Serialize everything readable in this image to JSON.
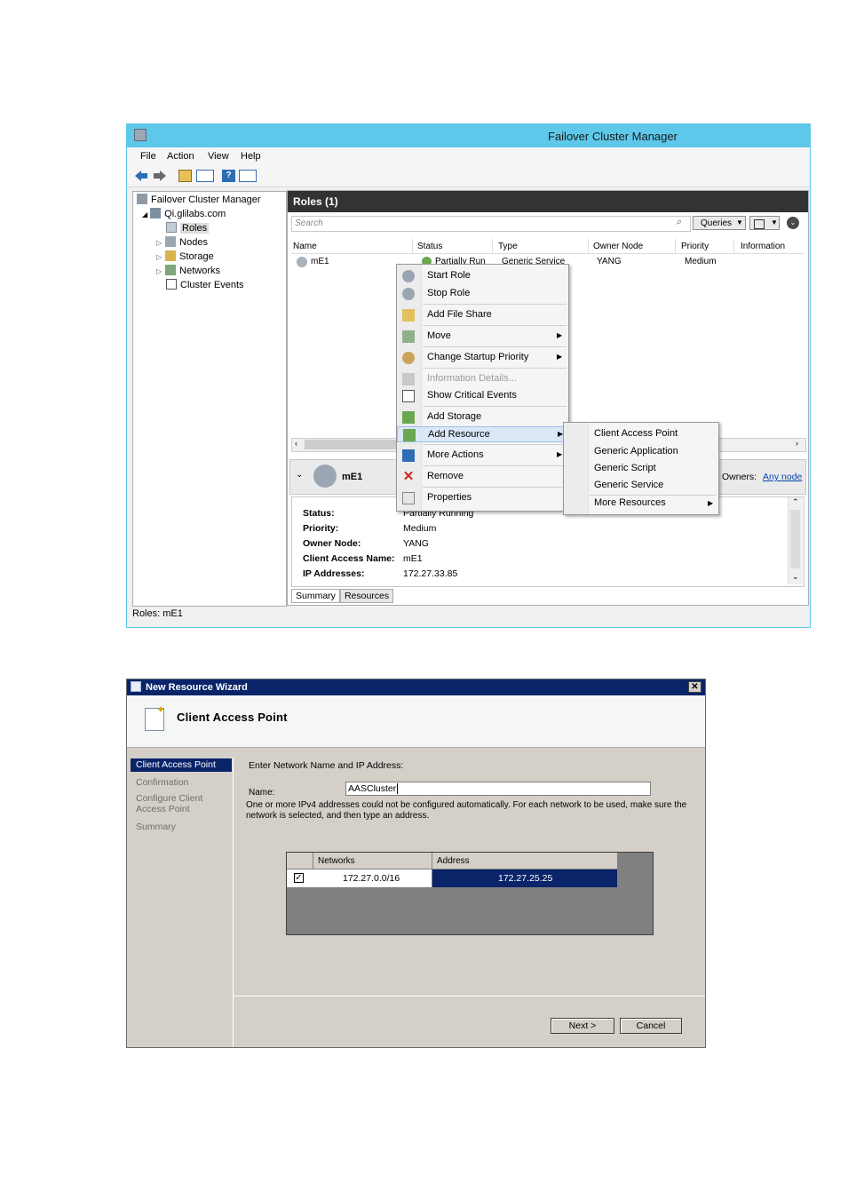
{
  "fcm": {
    "window_title": "Failover Cluster Manager",
    "menu": [
      "File",
      "Action",
      "View",
      "Help"
    ],
    "tree": {
      "root": "Failover Cluster Manager",
      "cluster": "Qi.glilabs.com",
      "items": [
        "Roles",
        "Nodes",
        "Storage",
        "Networks",
        "Cluster Events"
      ]
    },
    "roles_pane": {
      "header": "Roles (1)",
      "search_placeholder": "Search",
      "queries_label": "Queries",
      "columns": [
        "Name",
        "Status",
        "Type",
        "Owner Node",
        "Priority",
        "Information"
      ],
      "row": {
        "name": "mE1",
        "status": "Partially Run",
        "type": "Generic Service",
        "owner_node": "YANG",
        "priority": "Medium",
        "information": ""
      }
    },
    "details": {
      "title": "mE1",
      "owners_label": "Owners:",
      "owners_value": "Any node",
      "fields": [
        {
          "label": "Status:",
          "value": "Partially Running"
        },
        {
          "label": "Priority:",
          "value": "Medium"
        },
        {
          "label": "Owner Node:",
          "value": "YANG"
        },
        {
          "label": "Client Access Name:",
          "value": "mE1"
        },
        {
          "label": "IP Addresses:",
          "value": "172.27.33.85"
        }
      ],
      "tabs": [
        "Summary",
        "Resources"
      ]
    },
    "context_menu": [
      {
        "label": "Start Role",
        "icon": "start-role-icon"
      },
      {
        "label": "Stop Role",
        "icon": "stop-role-icon"
      },
      {
        "label": "Add File Share",
        "icon": "file-share-icon"
      },
      {
        "label": "Move",
        "icon": "move-icon",
        "submenu": true
      },
      {
        "label": "Change Startup Priority",
        "icon": "priority-icon",
        "submenu": true
      },
      {
        "label": "Information Details...",
        "icon": "info-details-icon",
        "disabled": true
      },
      {
        "label": "Show Critical Events",
        "icon": "events-icon"
      },
      {
        "label": "Add Storage",
        "icon": "add-storage-icon"
      },
      {
        "label": "Add Resource",
        "icon": "add-resource-icon",
        "submenu": true,
        "highlighted": true
      },
      {
        "label": "More Actions",
        "icon": "more-actions-icon",
        "submenu": true
      },
      {
        "label": "Remove",
        "icon": "remove-icon"
      },
      {
        "label": "Properties",
        "icon": "properties-icon"
      }
    ],
    "submenu": [
      "Client Access Point",
      "Generic Application",
      "Generic Script",
      "Generic Service",
      "More Resources"
    ],
    "status_bar": "Roles:  mE1"
  },
  "wizard": {
    "window_title": "New Resource Wizard",
    "heading": "Client Access Point",
    "nav": [
      "Client Access Point",
      "Confirmation",
      "Configure Client Access Point",
      "Summary"
    ],
    "prompt": "Enter Network Name and IP Address:",
    "name_label": "Name:",
    "name_value": "AASCluster",
    "info_text": "One or more IPv4 addresses could not be configured automatically.  For each network to be used, make sure the network is selected, and then type an address.",
    "grid_columns": [
      "Networks",
      "Address"
    ],
    "grid_row": {
      "network": "172.27.0.0/16",
      "address": "172.27.25.25",
      "checked": true
    },
    "next_label": "Next >",
    "cancel_label": "Cancel",
    "accent": "#0a246a"
  }
}
